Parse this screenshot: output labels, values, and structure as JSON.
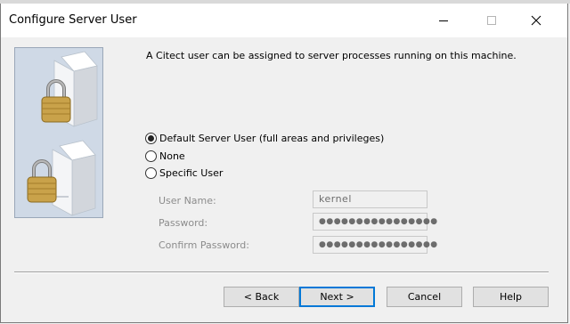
{
  "window": {
    "title": "Configure Server User"
  },
  "intro_text": "A Citect user can be assigned to server processes running on this machine.",
  "options": [
    {
      "label": "Default Server User (full areas and privileges)",
      "selected": true
    },
    {
      "label": "None",
      "selected": false
    },
    {
      "label": "Specific User",
      "selected": false
    }
  ],
  "fields": {
    "username": {
      "label": "User Name:",
      "value": "kernel"
    },
    "password": {
      "label": "Password:",
      "value": "●●●●●●●●●●●●●●●●"
    },
    "confirm": {
      "label": "Confirm Password:",
      "value": "●●●●●●●●●●●●●●●●"
    }
  },
  "buttons": {
    "back": "< Back",
    "next": "Next >",
    "cancel": "Cancel",
    "help": "Help"
  },
  "colors": {
    "accent": "#0078d7",
    "panel": "#cfd9e6",
    "padlock": "#c9a24a"
  },
  "icons": [
    "minimize-icon",
    "maximize-icon",
    "close-icon",
    "server-lock-icon"
  ]
}
